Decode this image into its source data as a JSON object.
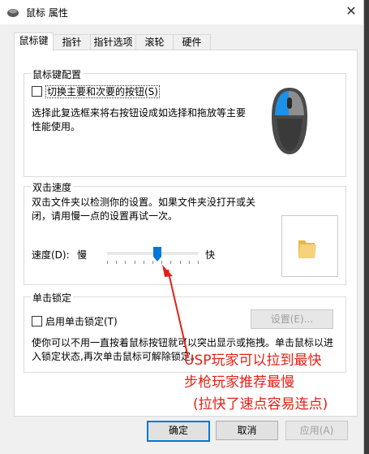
{
  "window": {
    "title": "鼠标 属性",
    "close_symbol": "✕"
  },
  "tabs": [
    {
      "label": "鼠标键",
      "active": true
    },
    {
      "label": "指针",
      "active": false
    },
    {
      "label": "指针选项",
      "active": false
    },
    {
      "label": "滚轮",
      "active": false
    },
    {
      "label": "硬件",
      "active": false
    }
  ],
  "button_config": {
    "group_label": "鼠标键配置",
    "swap_checkbox_label": "切换主要和次要的按钮(S)",
    "swap_checked": false,
    "description_line1": "选择此复选框来将右按钮设成如选择和拖放等主要",
    "description_line2": "性能使用。"
  },
  "double_click": {
    "group_label": "双击速度",
    "description_line1": "双击文件夹以检测你的设置。如果文件夹没打开或关",
    "description_line2": "闭，请用慢一点的设置再试一次。",
    "speed_label": "速度(D):",
    "slow_label": "慢",
    "fast_label": "快",
    "speed_value": 0.55
  },
  "click_lock": {
    "group_label": "单击锁定",
    "enable_label": "启用单击锁定(T)",
    "enable_checked": false,
    "settings_button": "设置(E)...",
    "description_line1": "使你可以不用一直按着鼠标按钮就可以突出显示或拖拽。单击鼠标以进",
    "description_line2": "入锁定状态,再次单击鼠标可解除锁定。"
  },
  "footer": {
    "ok": "确定",
    "cancel": "取消",
    "apply": "应用(A)"
  },
  "annotation": {
    "line1": "USP玩家可以拉到最快",
    "line2": "步枪玩家推荐最慢",
    "line3": "(拉快了速点容易连点)",
    "color": "#e32117"
  },
  "colors": {
    "accent": "#0078d7",
    "mouse_blue": "#1e90e8"
  },
  "icons": {
    "title": "mouse-icon",
    "preview": "folder-icon"
  }
}
